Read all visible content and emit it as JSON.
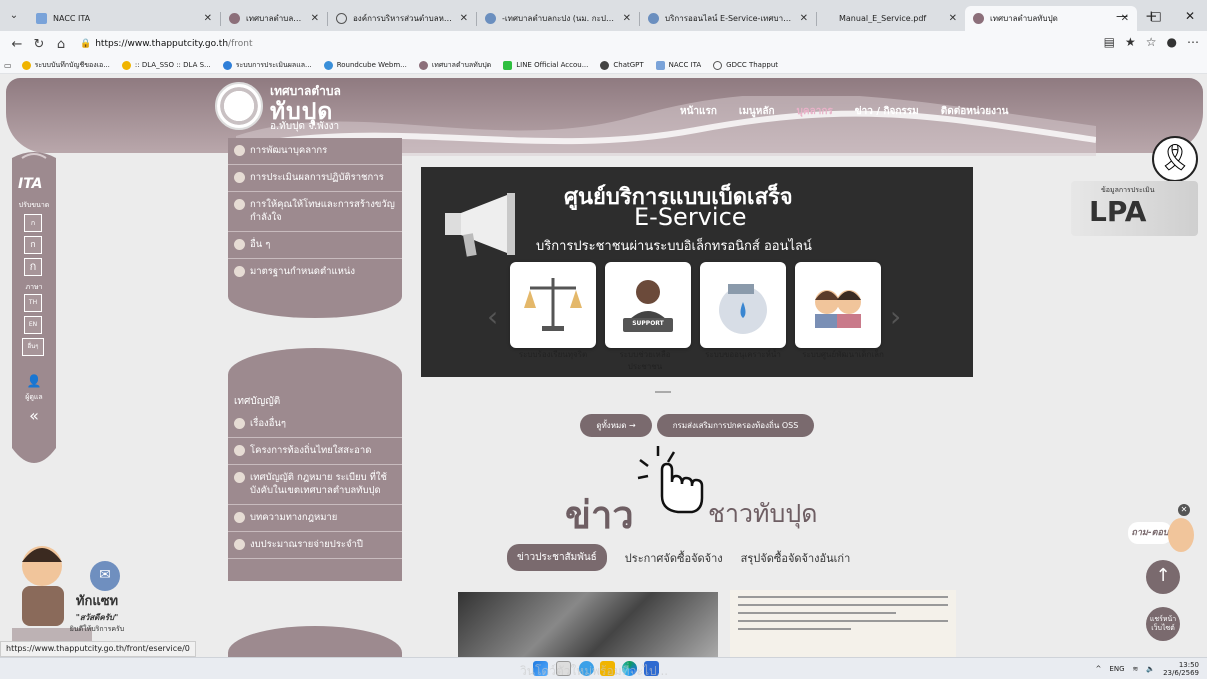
{
  "browser": {
    "tabs": [
      {
        "title": "NACC ITA",
        "color": "#7aa3d9",
        "active": false
      },
      {
        "title": "เทศบาลตำบลทับปุด",
        "color": "#8c6f7a",
        "active": false
      },
      {
        "title": "องค์การบริหารส่วนตำบลหมายเหตุ ผ.ถ. ...",
        "color": "#7b7b7b",
        "active": false
      },
      {
        "title": "-เทศบาลตำบลกะปง (นม. กะปง) ต ...",
        "color": "#6b8fbf",
        "active": false
      },
      {
        "title": "บริการออนไลน์ E-Service-เทศบาลตำบล...",
        "color": "#6b8fbf",
        "active": false
      },
      {
        "title": "Manual_E_Service.pdf",
        "color": "#c0392b",
        "active": false
      },
      {
        "title": "เทศบาลตำบลทับปุด",
        "color": "#8c6f7a",
        "active": true
      }
    ],
    "new_tab": "+",
    "window_controls": [
      "—",
      "□",
      "✕"
    ],
    "url_domain": "https://www.thapputcity.go.th",
    "url_path": "/front",
    "bookmarks": [
      {
        "label": "ระบบบันทึกบัญชีของเอ...",
        "color": "#f0b400"
      },
      {
        "label": ":: DLA_SSO :: DLA S...",
        "color": "#f0b400"
      },
      {
        "label": "ระบบการประเมินผลแล...",
        "color": "#2f7fd8"
      },
      {
        "label": "Roundcube Webm...",
        "color": "#3a8fd9"
      },
      {
        "label": "เทศบาลตำบลทับปุด",
        "color": "#8c6f7a"
      },
      {
        "label": "LINE Official Accou...",
        "color": "#2fbf3f"
      },
      {
        "label": "ChatGPT",
        "color": "#444444"
      },
      {
        "label": "NACC ITA",
        "color": "#7aa3d9"
      },
      {
        "label": "GDCC Thapput",
        "color": "#3a8fd9"
      }
    ]
  },
  "site": {
    "brand_top": "เทศบาลตำบล",
    "brand_main": "ทับปุด",
    "brand_sub": "อ.ทับปุด จ.พังงา",
    "nav": [
      "หน้าแรก",
      "เมนูหลัก",
      "บุคลากร",
      "ข่าว / กิจกรรม",
      "ติดต่อหน่วยงาน"
    ],
    "left_tool": {
      "ita": "ITA",
      "size_label": "ปรับขนาด",
      "size_btns": [
        "ก",
        "ก",
        "ก"
      ],
      "lang_label": "ภาษา",
      "lang_btns": [
        "TH",
        "EN"
      ],
      "more": "อื่นๆ",
      "user_label": "ผู้ดูแล",
      "collapse": "«"
    },
    "menu1": [
      "การพัฒนาบุคลากร",
      "การประเมินผลการปฏิบัติราชการ",
      "การให้คุณให้โทษและการสร้างขวัญกำลังใจ",
      "อื่น ๆ",
      "มาตรฐานกำหนดตำแหน่ง"
    ],
    "menu2_title": "เทศบัญญัติ",
    "menu2": [
      "เรื่องอื่นๆ",
      "โครงการท้องถิ่นไทยใสสะอาด",
      "เทศบัญญัติ กฎหมาย ระเบียบ ที่ใช้บังคับในเขตเทศบาลตำบลทับปุด",
      "บทความทางกฎหมาย",
      "งบประมาณรายจ่ายประจำปี"
    ],
    "banner": {
      "title": "ศูนย์บริการแบบเบ็ดเสร็จ",
      "title2": "E-Service",
      "subtitle": "บริการประชาชนผ่านระบบอิเล็กทรอนิกส์ ออนไลน์",
      "cards": [
        "ระบบร้องเรียนทุจริต",
        "ระบบช่วยเหลือประชาชน",
        "ระบบขออนุเคราะห์น้ำ",
        "ระบบศูนย์พัฒนาเด็กเล็ก"
      ],
      "support_text": "SUPPORT"
    },
    "btn_all": "ดูทั้งหมด →",
    "btn_oss": "กรมส่งเสริมการปกครองท้องถิ่น OSS",
    "news_title": "ข่าว",
    "news_title2": "ชาวทับปุด",
    "news_tabs": [
      "ข่าวประชาสัมพันธ์",
      "ประกาศจัดซื้อจัดจ้าง",
      "สรุปจัดซื้อจัดจ้างอันเก่า"
    ],
    "lpa_small": "ข้อมูลการประเมิน",
    "lpa": "LPA",
    "ribbon": "🎗",
    "qa": "ถาม-ตอบ",
    "up": "↑",
    "share": "แชร์หน้าเว็บไซต์",
    "mascot_name": "ทักแซท",
    "mascot_greet": "\"สวัสดีครับ\"",
    "mascot_sub": "ยินดีให้บริการครับ"
  },
  "status_url": "https://www.thapputcity.go.th/front/eservice/0",
  "taskbar": {
    "lang": "ENG",
    "time": "13:50",
    "date": "23/6/2569",
    "overlay": "วินโดว์ตัวใหม่พร้อมที่จะไป..."
  }
}
